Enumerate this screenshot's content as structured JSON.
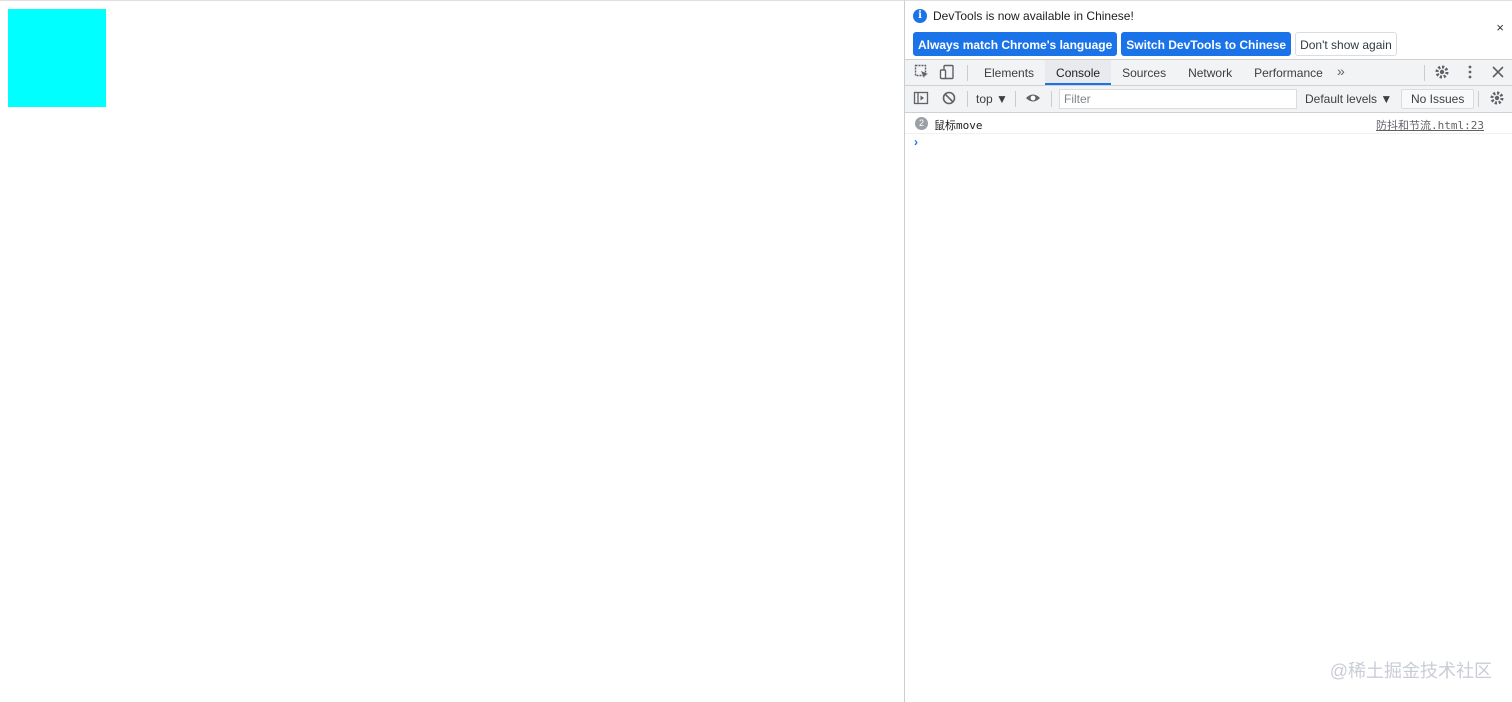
{
  "page": {
    "box_color": "#00ffff"
  },
  "devtools": {
    "infobar": {
      "info_icon": "info-icon",
      "message": "DevTools is now available in Chinese!",
      "buttons": [
        "Always match Chrome's language",
        "Switch DevTools to Chinese",
        "Don't show again"
      ],
      "close": "×"
    },
    "tabs": [
      "Elements",
      "Console",
      "Sources",
      "Network",
      "Performance"
    ],
    "active_tab": "Console",
    "more_tabs": "»",
    "toolbar": {
      "context": "top ▼",
      "filter_placeholder": "Filter",
      "levels": "Default levels ▼",
      "issues": "No Issues"
    },
    "console": {
      "messages": [
        {
          "count": "2",
          "text": "鼠标move",
          "source": "防抖和节流.html:23"
        }
      ],
      "prompt": "›"
    }
  },
  "watermark": "@稀土掘金技术社区",
  "colors": {
    "accent": "#1a73e8"
  }
}
